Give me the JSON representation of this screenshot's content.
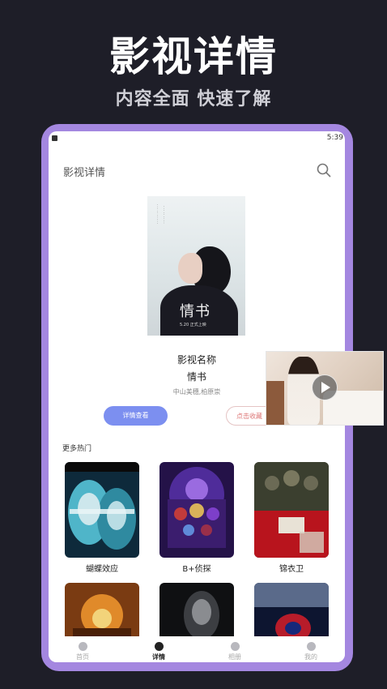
{
  "promo": {
    "title": "影视详情",
    "subtitle": "内容全面 快速了解"
  },
  "statusbar": {
    "time": "5:39"
  },
  "app": {
    "title": "影视详情"
  },
  "poster": {
    "title": "情书",
    "date": "5.20 正式上映"
  },
  "detail": {
    "label": "影视名称",
    "title": "情书",
    "cast": "中山美穗,柏原崇",
    "detail_button": "详情查看",
    "favorite_button": "点击收藏"
  },
  "section": {
    "title": "更多热门"
  },
  "movies": [
    {
      "title": "蝴蝶效应"
    },
    {
      "title": "B+侦探"
    },
    {
      "title": "锦衣卫"
    }
  ],
  "nav": {
    "items": [
      {
        "label": "首页"
      },
      {
        "label": "详情"
      },
      {
        "label": "相册"
      },
      {
        "label": "我的"
      }
    ],
    "active": "详情"
  },
  "colors": {
    "background": "#1e1e28",
    "frame": "#a487e0",
    "accent_button": "#7c8ff0"
  }
}
